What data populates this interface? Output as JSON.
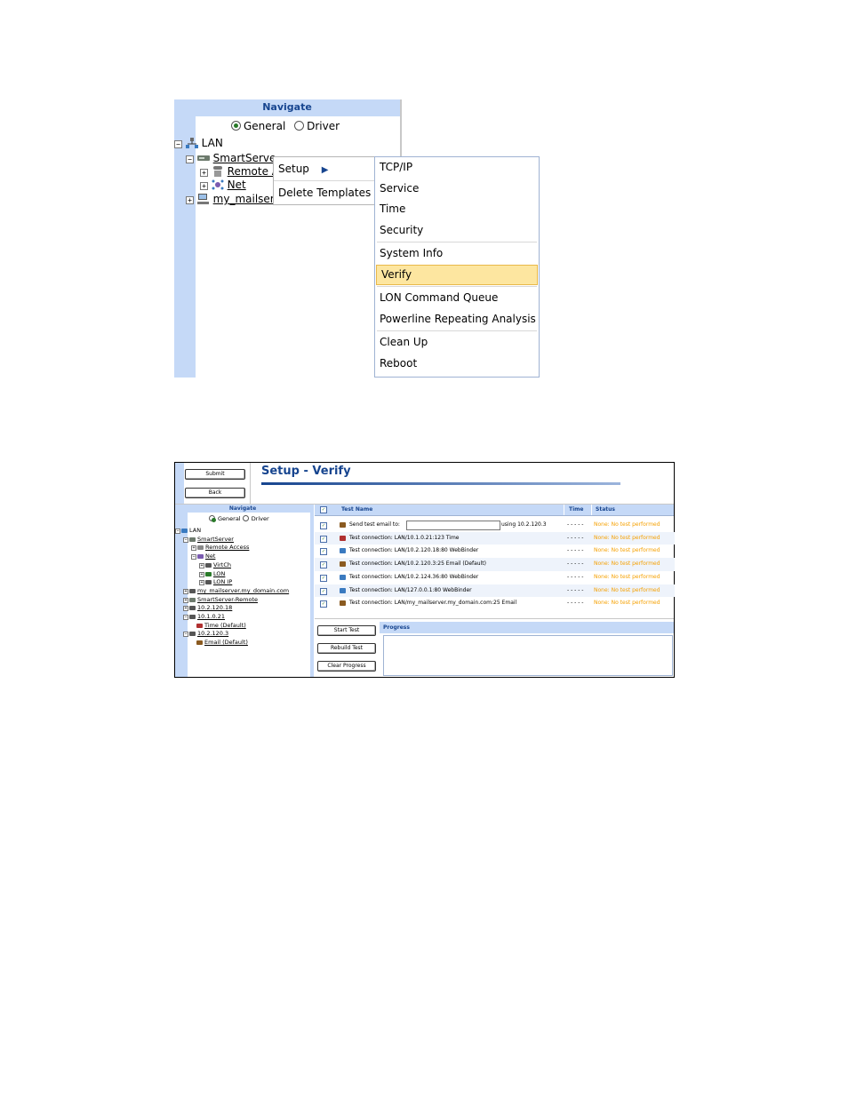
{
  "fig1": {
    "navigate_header": "Navigate",
    "radio_general": "General",
    "radio_driver": "Driver",
    "tree": {
      "lan": "LAN",
      "smartserver": "SmartServe",
      "remote": "Remote A",
      "net": "Net",
      "mailserver": "my_mailser"
    },
    "context_menu": {
      "setup": "Setup",
      "delete_templates": "Delete Templates"
    },
    "submenu": {
      "items": [
        "TCP/IP",
        "Service",
        "Time",
        "Security",
        "System Info",
        "Verify",
        "LON Command Queue",
        "Powerline Repeating Analysis",
        "Clean Up",
        "Reboot"
      ],
      "highlighted": "Verify"
    }
  },
  "fig2": {
    "submit_label": "Submit",
    "back_label": "Back",
    "page_title": "Setup - Verify",
    "navigate_header": "Navigate",
    "radio_general": "General",
    "radio_driver": "Driver",
    "tree": [
      "LAN",
      "SmartServer",
      "Remote Access",
      "Net",
      "VirtCh",
      "LON",
      "LON IP",
      "my_mailserver.my_domain.com",
      "SmartServer-Remote",
      "10.2.120.18",
      "10.1.0.21",
      "Time (Default)",
      "10.2.120.3",
      "Email (Default)"
    ],
    "table": {
      "col_test_name": "Test Name",
      "col_time": "Time",
      "col_status": "Status",
      "email_row_label": "Send test email to:",
      "email_row_suffix": "using 10.2.120.3",
      "rows": [
        "Test connection: LAN/10.1.0.21:123 Time",
        "Test connection: LAN/10.2.120.18:80 WebBinder",
        "Test connection: LAN/10.2.120.3:25 Email (Default)",
        "Test connection: LAN/10.2.124.36:80 WebBinder",
        "Test connection: LAN/127.0.0.1:80 WebBinder",
        "Test connection: LAN/my_mailserver.my_domain.com:25 Email"
      ],
      "time_placeholder": "- - - - -",
      "status_text": "None: No test performed"
    },
    "start_test": "Start Test",
    "rebuild_test": "Rebuild Test",
    "clear_progress": "Clear Progress",
    "progress_header": "Progress",
    "accent_color": "#17458f",
    "status_color": "#f5a000"
  }
}
